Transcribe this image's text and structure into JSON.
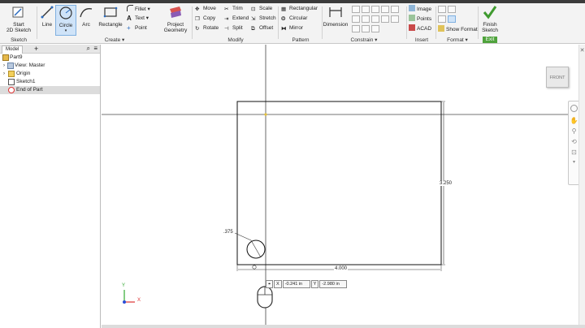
{
  "ribbon": {
    "sketch_group": {
      "label": "Sketch",
      "start_label": "Start\n2D Sketch"
    },
    "create_group": {
      "label": "Create",
      "line": "Line",
      "circle": "Circle",
      "arc": "Arc",
      "rectangle": "Rectangle",
      "fillet": "Fillet",
      "text": "Text",
      "point": "Point",
      "project_geometry": "Project\nGeometry"
    },
    "modify_group": {
      "label": "Modify",
      "move": "Move",
      "trim": "Trim",
      "scale": "Scale",
      "copy": "Copy",
      "extend": "Extend",
      "stretch": "Stretch",
      "rotate": "Rotate",
      "split": "Split",
      "offset": "Offset"
    },
    "pattern_group": {
      "label": "Pattern",
      "rectangular": "Rectangular",
      "circular": "Circular",
      "mirror": "Mirror"
    },
    "constrain_group": {
      "label": "Constrain",
      "dimension": "Dimension"
    },
    "insert_group": {
      "label": "Insert",
      "image": "Image",
      "points": "Points",
      "acad": "ACAD"
    },
    "format_group": {
      "label": "Format",
      "show_format": "Show Format"
    },
    "exit_group": {
      "label": "Exit",
      "finish": "Finish\nSketch"
    }
  },
  "browser": {
    "tab": "Model",
    "add": "+",
    "items": [
      {
        "label": "Part9",
        "icon": "part-icon"
      },
      {
        "label": "View: Master",
        "icon": "view-icon"
      },
      {
        "label": "Origin",
        "icon": "folder-icon"
      },
      {
        "label": "Sketch1",
        "icon": "sketch-icon"
      },
      {
        "label": "End of Part",
        "icon": "end-of-part-icon"
      }
    ]
  },
  "canvas": {
    "viewcube_face": "FRONT",
    "dim_width": "4.000",
    "dim_height": "3.250",
    "dim_circle": ".375",
    "axis_x": "X",
    "axis_y": "Y"
  },
  "coords": {
    "x_label": "X",
    "x_value": "-0.241 in",
    "y_label": "Y",
    "y_value": "-2.980 in"
  },
  "colors": {
    "accent_select": "#cfe3f8",
    "exit_green": "#4fa33c",
    "sketch_line": "#111111"
  }
}
